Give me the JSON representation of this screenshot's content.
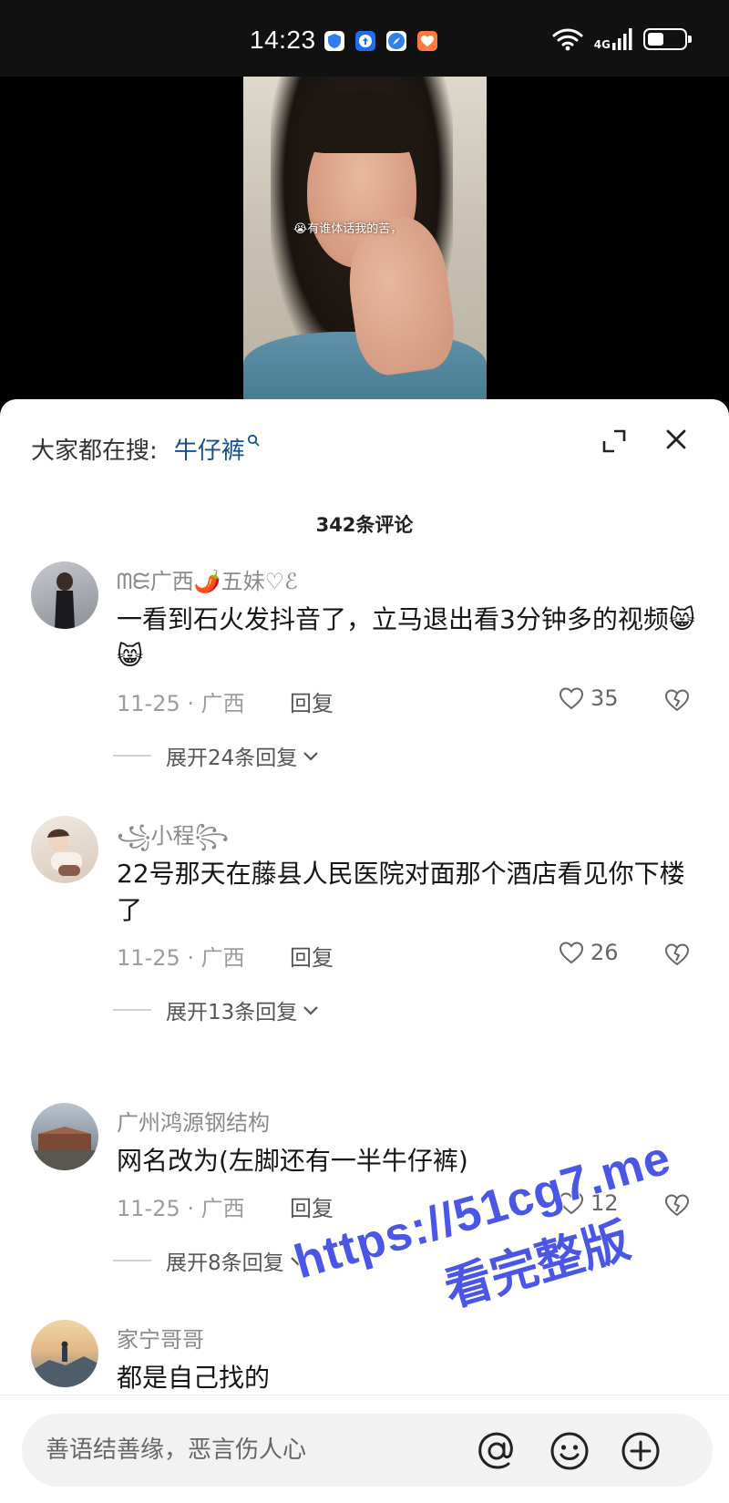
{
  "status_bar": {
    "time": "14:23",
    "network": "4G",
    "battery_level": 0.45,
    "app_icons": [
      {
        "name": "shield-app-icon",
        "color": "#2f7bf0"
      },
      {
        "name": "upload-app-icon",
        "color": "#1f6fea"
      },
      {
        "name": "compass-app-icon",
        "color": "#2f80ed"
      },
      {
        "name": "heart-app-icon",
        "color": "#ff7a3d"
      }
    ]
  },
  "video": {
    "caption": "😭有谁体话我的苦，"
  },
  "panel": {
    "search_prefix": "大家都在搜:",
    "search_term": "牛仔裤",
    "comment_count": "342条评论"
  },
  "comments": [
    {
      "username": "ᗰᙓ广西🌶️五妹♡ℰ",
      "text": "一看到石火发抖音了，立马退出看3分钟多的视频😸😸",
      "meta": "11-25 · 广西",
      "reply_label": "回复",
      "likes": "35",
      "expand_label": "展开24条回复"
    },
    {
      "username": "꧁小程꧂",
      "text": "22号那天在藤县人民医院对面那个酒店看见你下楼了",
      "meta": "11-25 · 广西",
      "reply_label": "回复",
      "likes": "26",
      "expand_label": "展开13条回复"
    },
    {
      "username": "广州鸿源钢结构",
      "text": "网名改为(左脚还有一半牛仔裤)",
      "meta": "11-25 · 广西",
      "reply_label": "回复",
      "likes": "12",
      "expand_label": "展开8条回复"
    },
    {
      "username": "家宁哥哥",
      "text": "都是自己找的"
    }
  ],
  "watermark": {
    "url": "https://51cg7.me",
    "sub": "看完整版"
  },
  "input_bar": {
    "placeholder": "善语结善缘，恶言伤人心"
  },
  "colors": {
    "search_term": "#14508f",
    "watermark": "#4a57e6"
  }
}
